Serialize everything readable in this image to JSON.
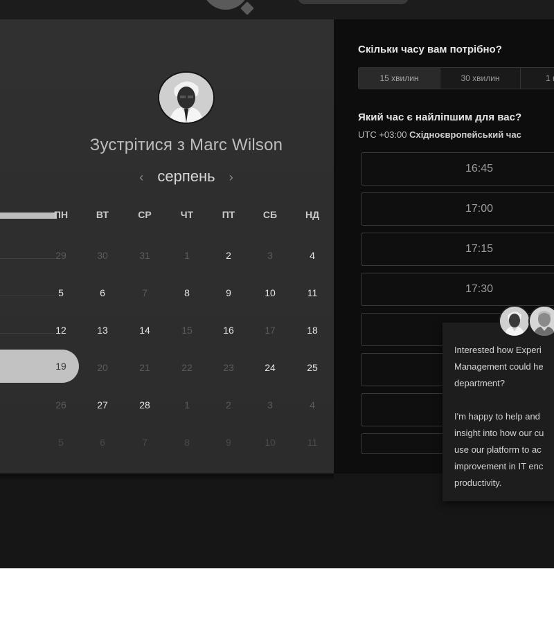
{
  "host": {
    "title_prefix": "Зустрітися з ",
    "name": "Marc Wilson"
  },
  "calendar": {
    "month": "серпень",
    "prev_icon": "chevron-left-icon",
    "next_icon": "chevron-right-icon",
    "weekdays": [
      "ПН",
      "ВТ",
      "СР",
      "ЧТ",
      "ПТ",
      "СБ",
      "НД"
    ],
    "weeks": [
      [
        "29",
        "30",
        "31",
        "1",
        "2",
        "3",
        "4"
      ],
      [
        "5",
        "6",
        "7",
        "8",
        "9",
        "10",
        "11"
      ],
      [
        "12",
        "13",
        "14",
        "15",
        "16",
        "17",
        "18"
      ],
      [
        "19",
        "20",
        "21",
        "22",
        "23",
        "24",
        "25"
      ],
      [
        "26",
        "27",
        "28",
        "1",
        "2",
        "3",
        "4"
      ],
      [
        "5",
        "6",
        "7",
        "8",
        "9",
        "10",
        "11"
      ]
    ],
    "selected_day": "19"
  },
  "duration": {
    "question": "Скільки часу вам потрібно?",
    "options": [
      "15 хвилин",
      "30 хвилин",
      "1 г"
    ]
  },
  "time": {
    "question": "Який час є найліпшим для вас?",
    "timezone_offset": "UTC +03:00",
    "timezone_name": "Східноєвропейський час",
    "slots": [
      "16:45",
      "17:00",
      "17:15",
      "17:30",
      "",
      "",
      ""
    ]
  },
  "chat_popup": {
    "message": "Interested how Experi\nManagement could he\ndepartment?\n\nI'm happy to help and\ninsight into how our cu\nuse our platform to ac\nimprovement in IT enc\nproductivity."
  },
  "colors": {
    "page_bg": "#161616",
    "left_panel": "#2e2e2e",
    "right_panel": "#0d0d0d",
    "selected_pill": "#c2c2c2"
  }
}
